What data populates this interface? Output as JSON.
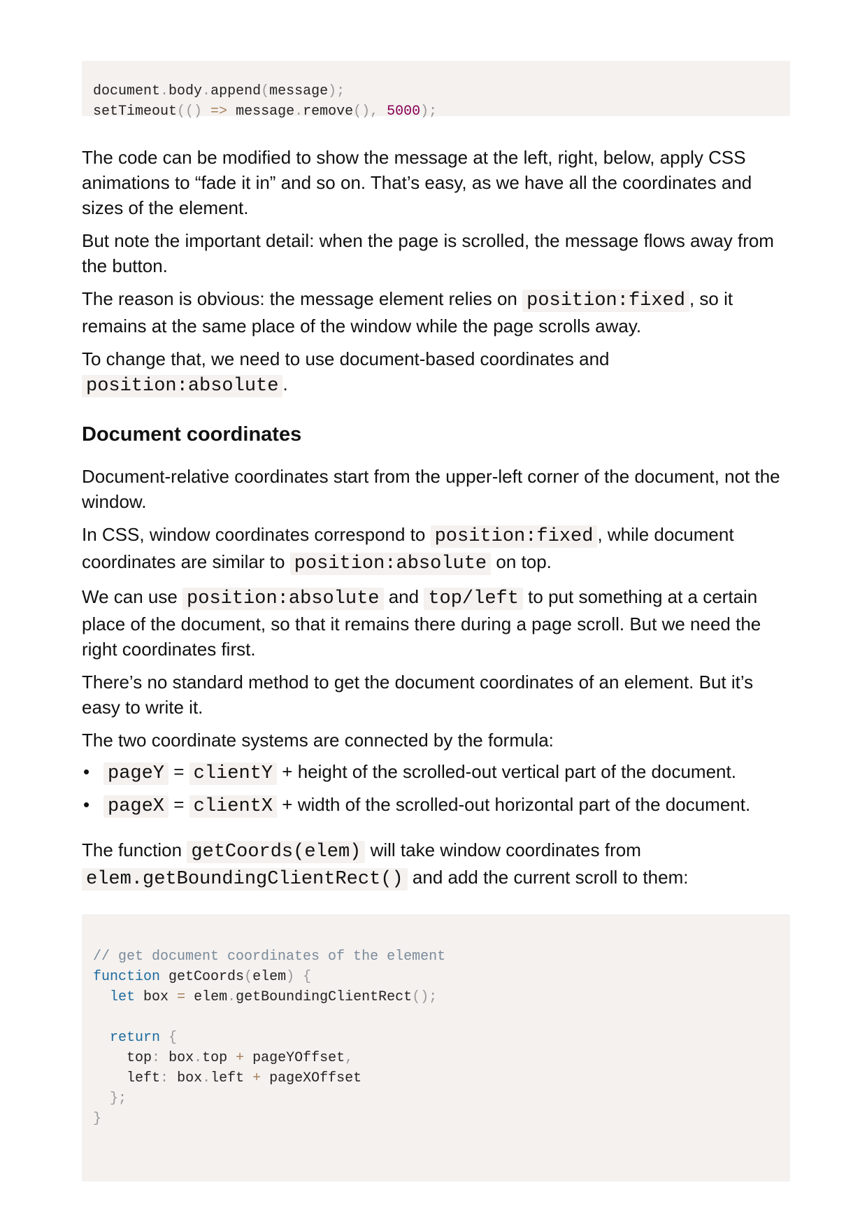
{
  "code1": {
    "line1": {
      "a": "document",
      "b": "body",
      "c": "append",
      "d": "message"
    },
    "line2": {
      "a": "setTimeout",
      "b": "=>",
      "c": "message",
      "d": "remove",
      "e": "5000"
    }
  },
  "paragraphs": {
    "p1": "The code can be modified to show the message at the left, right, below, apply CSS animations to “fade it in” and so on. That’s easy, as we have all the coordinates and sizes of the element.",
    "p2": "But note the important detail: when the page is scrolled, the message flows away from the button.",
    "p3": {
      "t1": "The reason is obvious: the message element relies on ",
      "c1": "position:fixed",
      "t2": ", so it remains at the same place of the window while the page scrolls away."
    },
    "p4": {
      "t1": "To change that, we need to use document-based coordinates and ",
      "c1": "position:absolute",
      "t2": "."
    }
  },
  "section": {
    "heading": "Document coordinates",
    "p1": "Document-relative coordinates start from the upper-left corner of the document, not the window.",
    "p2": {
      "t1": "In CSS, window coordinates correspond to ",
      "c1": "position:fixed",
      "t2": ", while document coordinates are similar to ",
      "c2": "position:absolute",
      "t3": " on top."
    },
    "p3": {
      "t1": "We can use ",
      "c1": "position:absolute",
      "t2": " and ",
      "c2": "top/left",
      "t3": " to put something at a certain place of the document, so that it remains there during a page scroll. But we need the right coordinates first."
    },
    "p4": "There’s no standard method to get the document coordinates of an element. But it’s easy to write it.",
    "p5": "The two coordinate systems are connected by the formula:",
    "bullets": [
      {
        "dot": "•",
        "c1": "pageY",
        "eq": " = ",
        "c2": "clientY",
        "t": " + height of the scrolled-out vertical part of the document."
      },
      {
        "dot": "•",
        "c1": "pageX",
        "eq": " = ",
        "c2": "clientX",
        "t": " + width of the scrolled-out horizontal part of the document."
      }
    ],
    "p6": {
      "t1": "The function ",
      "c1": "getCoords(elem)",
      "t2": " will take window coordinates from ",
      "c2": "elem.getBoundingClientRect()",
      "t3": " and add the current scroll to them:"
    }
  },
  "code2": {
    "comment": "// get document coordinates of the element",
    "kw_function": "function",
    "fn_name": "getCoords",
    "param": "elem",
    "kw_let": "let",
    "var_box": "box",
    "obj_elem": "elem",
    "method": "getBoundingClientRect",
    "kw_return": "return",
    "prop_top": "top",
    "box_top": "box",
    "top_prop": "top",
    "page_y": "pageYOffset",
    "prop_left": "left",
    "box_left": "box",
    "left_prop": "left",
    "page_x": "pageXOffset"
  }
}
